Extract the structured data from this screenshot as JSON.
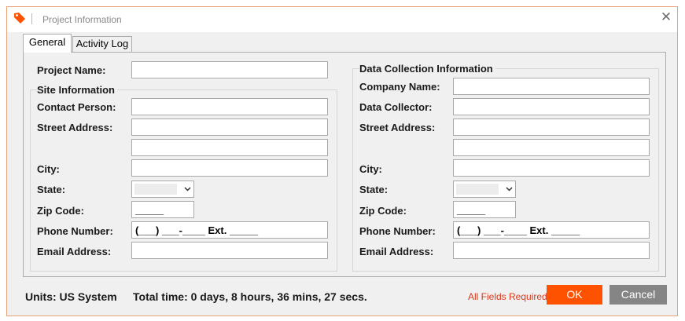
{
  "window": {
    "title": "Project Information",
    "close_symbol": "✕",
    "accent_color": "#ff5200"
  },
  "tabs": [
    {
      "label": "General",
      "active": true
    },
    {
      "label": "Activity Log",
      "active": false
    }
  ],
  "left": {
    "project_name_label": "Project Name:",
    "project_name_value": "",
    "site_info_title": "Site Information",
    "contact_person_label": "Contact Person:",
    "contact_person_value": "",
    "street_address_label": "Street Address:",
    "street_address_1": "",
    "street_address_2": "",
    "city_label": "City:",
    "city_value": "",
    "state_label": "State:",
    "zip_label": "Zip Code:",
    "zip_value": "_____",
    "phone_label": "Phone Number:",
    "phone_value": "(___) ___-____ Ext. _____",
    "email_label": "Email Address:",
    "email_value": ""
  },
  "right": {
    "section_title": "Data Collection Information",
    "company_label": "Company Name:",
    "company_value": "",
    "collector_label": "Data Collector:",
    "collector_value": "",
    "street_address_label": "Street Address:",
    "street_address_1": "",
    "street_address_2": "",
    "city_label": "City:",
    "city_value": "",
    "state_label": "State:",
    "zip_label": "Zip Code:",
    "zip_value": "_____",
    "phone_label": "Phone Number:",
    "phone_value": "(___) ___-____ Ext. _____",
    "email_label": "Email Address:",
    "email_value": ""
  },
  "footer": {
    "units": "Units: US System",
    "total_time": "Total time: 0 days, 8 hours, 36 mins, 27 secs.",
    "required_note": "All Fields Required",
    "ok_label": "OK",
    "cancel_label": "Cancel"
  },
  "icons": {
    "app": "tag-icon",
    "close": "close-icon",
    "dropdown": "chevron-down-icon"
  }
}
